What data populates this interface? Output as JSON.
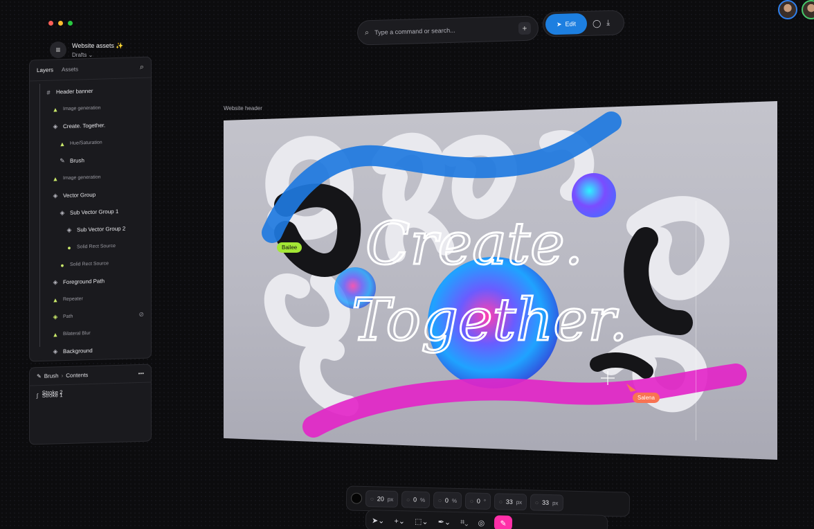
{
  "window": {
    "traffic": [
      "#ff5f57",
      "#febc2e",
      "#28c840"
    ]
  },
  "project": {
    "name": "Website assets",
    "sparkle": "✨",
    "status": "Drafts"
  },
  "command_bar": {
    "placeholder": "Type a command or search...",
    "add_label": "+"
  },
  "actions": {
    "edit_label": "Edit",
    "accent": "#1d7fe0"
  },
  "layers_panel": {
    "tabs": [
      "Layers",
      "Assets"
    ],
    "items": [
      {
        "label": "Header banner",
        "icon": "frame-icon",
        "glyph": "#",
        "indent": 0,
        "dim": false
      },
      {
        "label": "Image generation",
        "icon": "generate-icon",
        "glyph": "▲",
        "indent": 1,
        "dim": true
      },
      {
        "label": "Create. Together.",
        "icon": "layers-icon",
        "glyph": "◈",
        "indent": 1,
        "dim": false
      },
      {
        "label": "Hue/Saturation",
        "icon": "adjust-icon",
        "glyph": "▲",
        "indent": 2,
        "dim": true
      },
      {
        "label": "Brush",
        "icon": "brush-icon",
        "glyph": "✎",
        "indent": 2,
        "dim": false
      },
      {
        "label": "Image generation",
        "icon": "generate-icon",
        "glyph": "▲",
        "indent": 1,
        "dim": true
      },
      {
        "label": "Vector Group",
        "icon": "vector-group-icon",
        "glyph": "◈",
        "indent": 1,
        "dim": false
      },
      {
        "label": "Sub Vector Group 1",
        "icon": "layers-icon",
        "glyph": "◈",
        "indent": 2,
        "dim": false
      },
      {
        "label": "Sub Vector Group 2",
        "icon": "layers-icon",
        "glyph": "◈",
        "indent": 3,
        "dim": false
      },
      {
        "label": "Solid Rect Source",
        "icon": "source-icon",
        "glyph": "●",
        "indent": 3,
        "dim": true
      },
      {
        "label": "Solid Rect Source",
        "icon": "source-icon",
        "glyph": "●",
        "indent": 2,
        "dim": true
      },
      {
        "label": "Foreground Path",
        "icon": "layers-icon",
        "glyph": "◈",
        "indent": 1,
        "dim": false
      },
      {
        "label": "Repeater",
        "icon": "repeater-icon",
        "glyph": "▲",
        "indent": 1,
        "dim": true
      },
      {
        "label": "Path",
        "icon": "path-icon",
        "glyph": "◈",
        "indent": 1,
        "dim": true
      },
      {
        "label": "Bilateral Blur",
        "icon": "blur-icon",
        "glyph": "▲",
        "indent": 1,
        "dim": true
      },
      {
        "label": "Background",
        "icon": "background-icon",
        "glyph": "◈",
        "indent": 1,
        "dim": false
      }
    ]
  },
  "brush_panel": {
    "crumb": [
      "Brush",
      "Contents"
    ],
    "more": "•••",
    "strokes": [
      "Stroke 2",
      "Stroke 1"
    ]
  },
  "canvas": {
    "frame_label": "Website header",
    "headline_line1": "Create.",
    "headline_line2": "Together.",
    "cursors": [
      {
        "name": "Bailee",
        "color": "#a3e635"
      },
      {
        "name": "Salena",
        "color": "#f97352"
      }
    ],
    "stroke_colors": {
      "blue": "#1f79e0",
      "magenta": "#e323c8"
    }
  },
  "properties": [
    {
      "icon": "brush-size-icon",
      "value": "20",
      "unit": "px"
    },
    {
      "icon": "opacity-icon",
      "value": "0",
      "unit": "%"
    },
    {
      "icon": "flow-icon",
      "value": "0",
      "unit": "%"
    },
    {
      "icon": "angle-icon",
      "value": "0",
      "unit": "°"
    },
    {
      "icon": "spacing-icon",
      "value": "33",
      "unit": "px"
    },
    {
      "icon": "width-icon",
      "value": "33",
      "unit": "px"
    }
  ]
}
